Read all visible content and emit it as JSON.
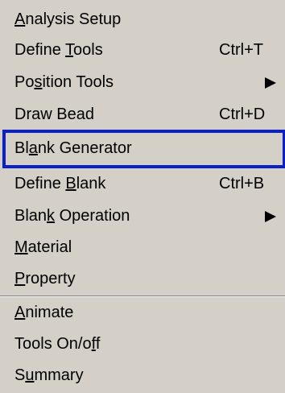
{
  "menu": {
    "items": [
      {
        "pre": "",
        "mnemonic": "A",
        "post": "nalysis Setup",
        "shortcut": "",
        "submenu": false
      },
      {
        "pre": "Define ",
        "mnemonic": "T",
        "post": "ools",
        "shortcut": "Ctrl+T",
        "submenu": false
      },
      {
        "pre": "Po",
        "mnemonic": "s",
        "post": "ition Tools",
        "shortcut": "",
        "submenu": true
      },
      {
        "pre": "Draw Bead",
        "mnemonic": "",
        "post": "",
        "shortcut": "Ctrl+D",
        "submenu": false
      },
      {
        "pre": "Bl",
        "mnemonic": "a",
        "post": "nk Generator",
        "shortcut": "",
        "submenu": false,
        "highlighted": true
      },
      {
        "pre": "Define ",
        "mnemonic": "B",
        "post": "lank",
        "shortcut": "Ctrl+B",
        "submenu": false
      },
      {
        "pre": "Blan",
        "mnemonic": "k",
        "post": " Operation",
        "shortcut": "",
        "submenu": true
      },
      {
        "pre": "",
        "mnemonic": "M",
        "post": "aterial",
        "shortcut": "",
        "submenu": false
      },
      {
        "pre": "",
        "mnemonic": "P",
        "post": "roperty",
        "shortcut": "",
        "submenu": false
      },
      {
        "pre": "",
        "mnemonic": "A",
        "post": "nimate",
        "shortcut": "",
        "submenu": false
      },
      {
        "pre": "Tools On/o",
        "mnemonic": "f",
        "post": "f",
        "shortcut": "",
        "submenu": false
      },
      {
        "pre": "S",
        "mnemonic": "u",
        "post": "mmary",
        "shortcut": "",
        "submenu": false
      }
    ],
    "highlight_color": "#0a1fc8",
    "background_color": "#d4d0c8"
  }
}
